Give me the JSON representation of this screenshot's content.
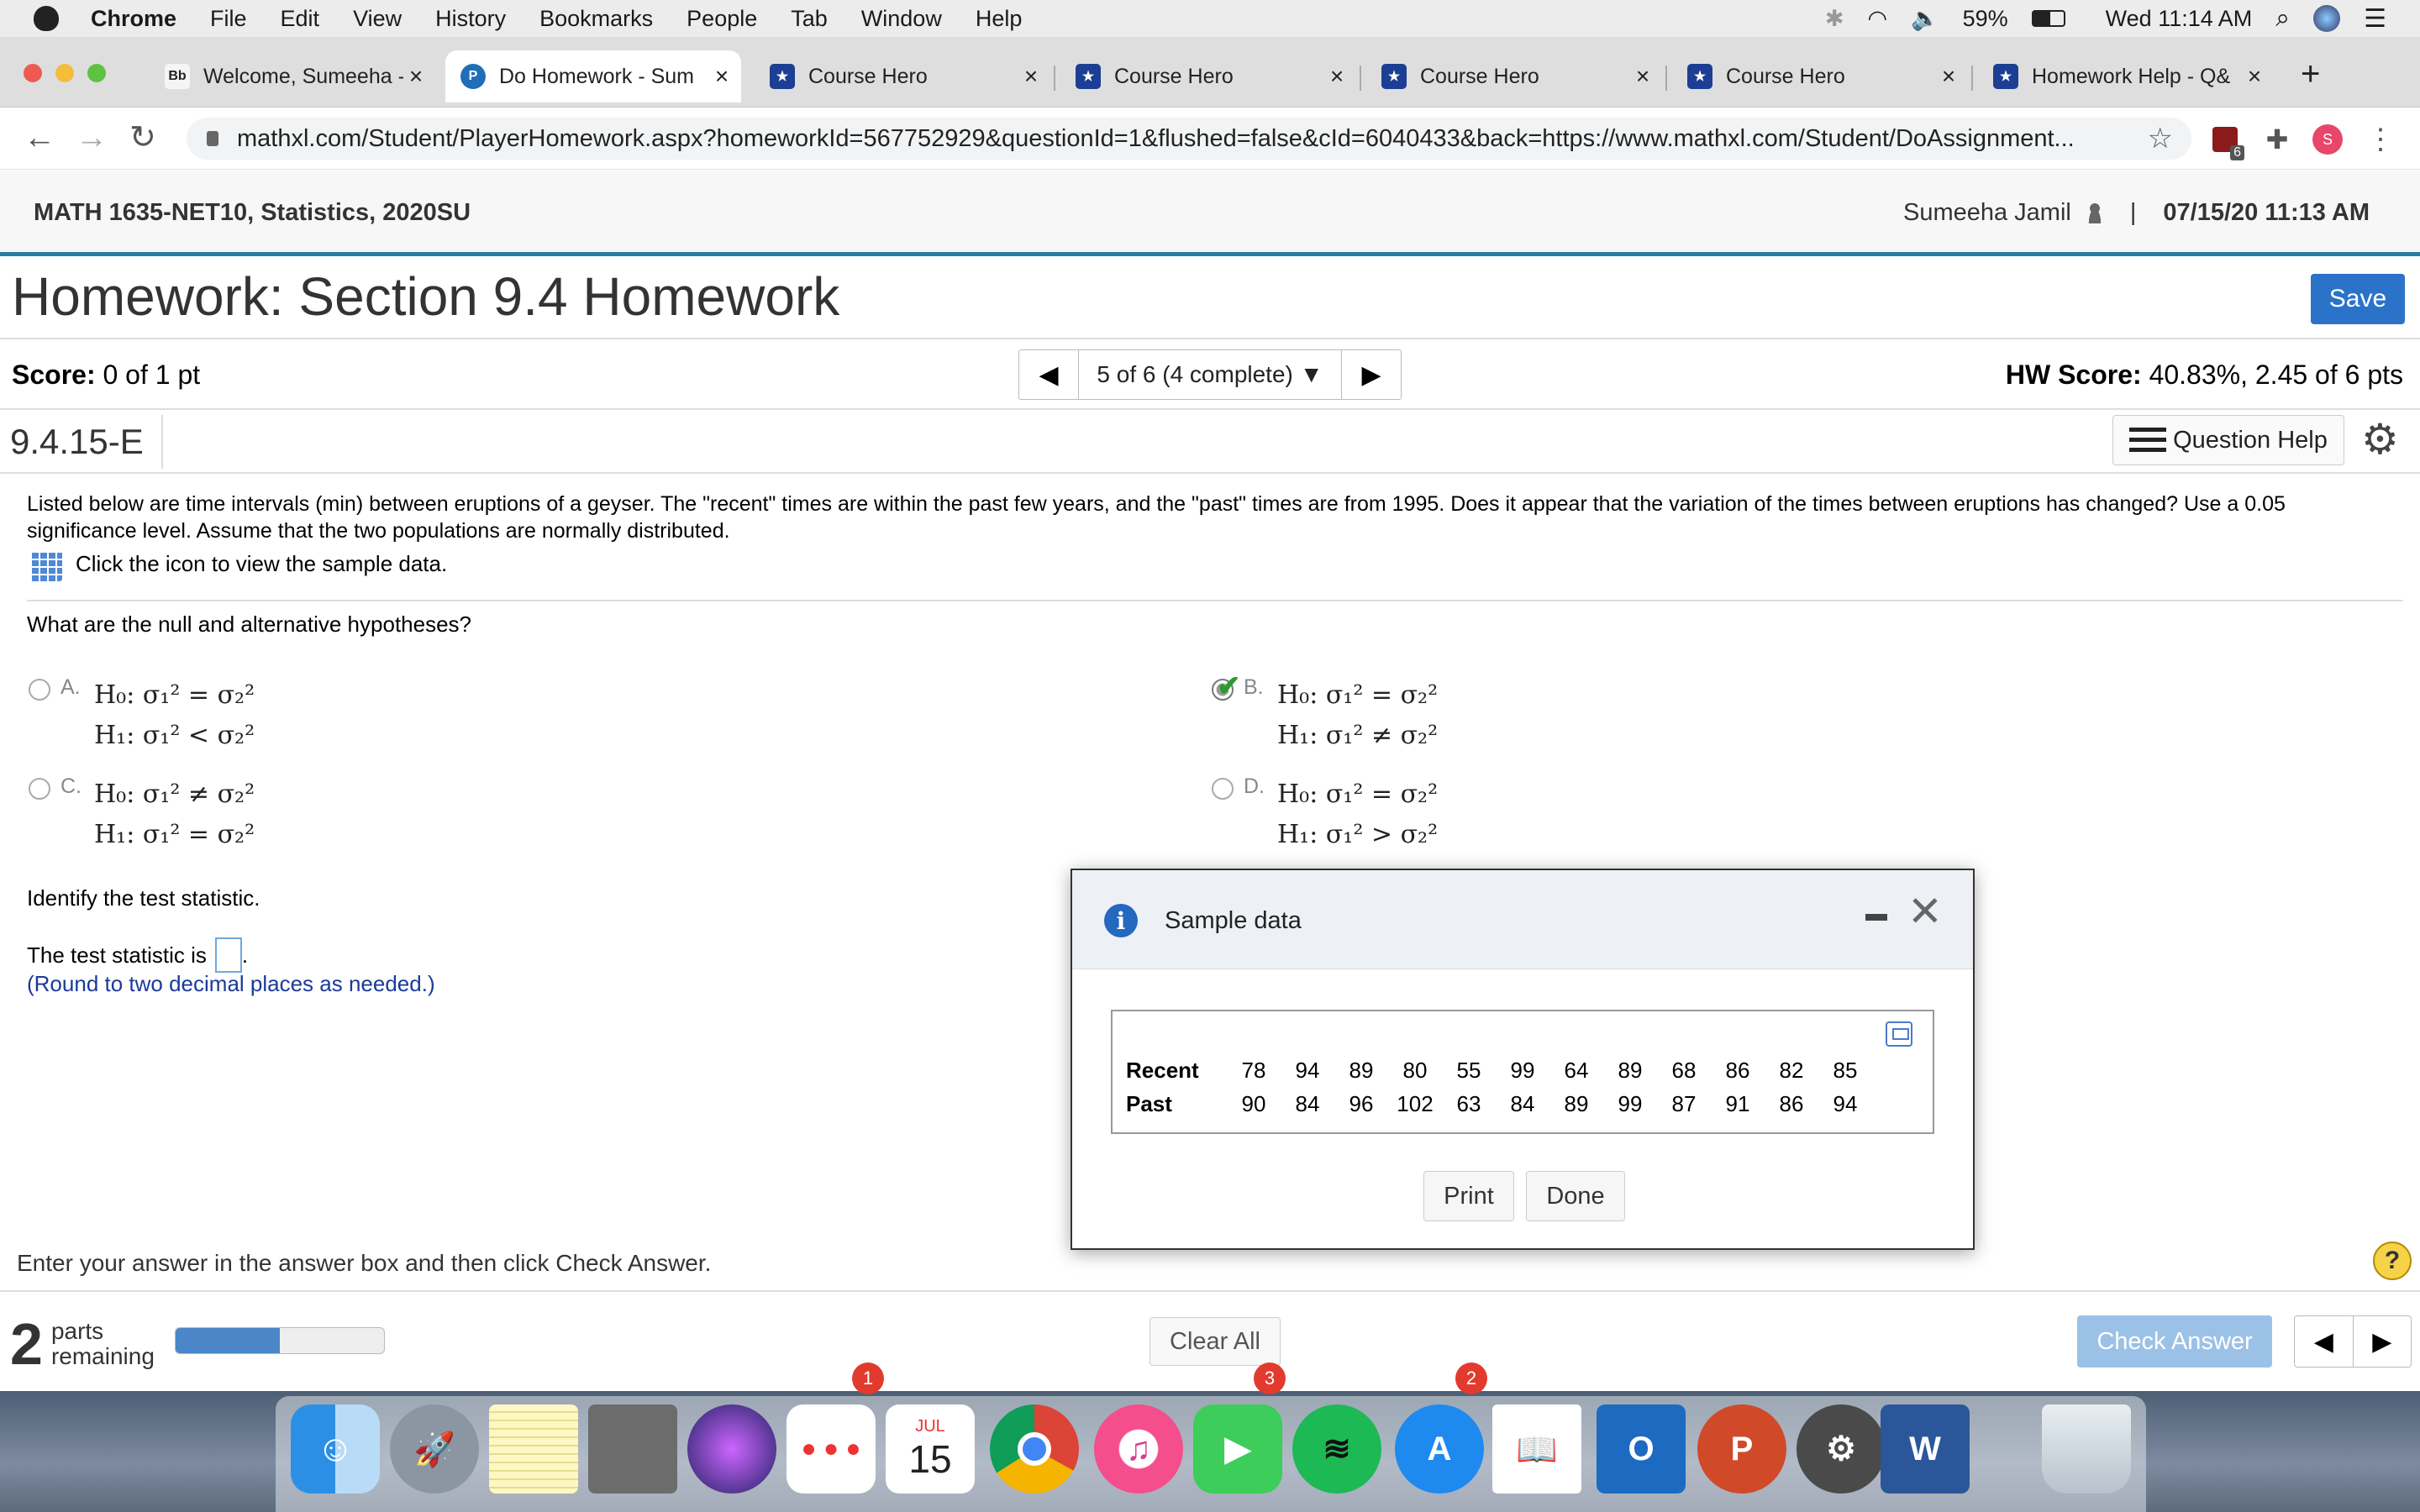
{
  "menubar": {
    "items": [
      "Chrome",
      "File",
      "Edit",
      "View",
      "History",
      "Bookmarks",
      "People",
      "Tab",
      "Window",
      "Help"
    ],
    "battery": "59%",
    "clock": "Wed 11:14 AM"
  },
  "tabs": [
    {
      "label": "Welcome, Sumeeha -",
      "fav": "Bb",
      "favcolor": "#f5f5f5",
      "favtext": "#222"
    },
    {
      "label": "Do Homework - Sum",
      "fav": "P",
      "favcolor": "#1e6fb8",
      "favtext": "#fff"
    },
    {
      "label": "Course Hero",
      "fav": "★",
      "favcolor": "#1c3f94",
      "favtext": "#fff"
    },
    {
      "label": "Course Hero",
      "fav": "★",
      "favcolor": "#1c3f94",
      "favtext": "#fff"
    },
    {
      "label": "Course Hero",
      "fav": "★",
      "favcolor": "#1c3f94",
      "favtext": "#fff"
    },
    {
      "label": "Course Hero",
      "fav": "★",
      "favcolor": "#1c3f94",
      "favtext": "#fff"
    },
    {
      "label": "Homework Help - Q&",
      "fav": "★",
      "favcolor": "#1c3f94",
      "favtext": "#fff"
    }
  ],
  "address": {
    "url": "mathxl.com/Student/PlayerHomework.aspx?homeworkId=567752929&questionId=1&flushed=false&cId=6040433&back=https://www.mathxl.com/Student/DoAssignment...",
    "ext_badge": "6",
    "profile": "S"
  },
  "course": {
    "title": "MATH 1635-NET10, Statistics, 2020SU",
    "user": "Sumeeha Jamil",
    "date": "07/15/20 11:13 AM"
  },
  "homework": {
    "title": "Homework: Section 9.4 Homework",
    "save": "Save",
    "score_label": "Score:",
    "score_value": "0 of 1 pt",
    "question_nav": "5 of 6 (4 complete)",
    "hw_score_label": "HW Score:",
    "hw_score_value": "40.83%, 2.45 of 6 pts",
    "question_id": "9.4.15-E",
    "question_help": "Question Help"
  },
  "question": {
    "text": "Listed below are time intervals (min) between eruptions of a geyser. The \"recent\" times are within the past few years, and the \"past\" times are from 1995. Does it appear that the variation of the times between eruptions has changed? Use a 0.05 significance level. Assume that the two populations are normally distributed.",
    "sample_link": "Click the icon to view the sample data.",
    "hyp_prompt": "What are the null and alternative hypotheses?",
    "options": [
      {
        "letter": "A.",
        "h0": "H₀: σ₁² = σ₂²",
        "h1": "H₁: σ₁² < σ₂²"
      },
      {
        "letter": "B.",
        "h0": "H₀: σ₁² = σ₂²",
        "h1": "H₁: σ₁² ≠ σ₂²"
      },
      {
        "letter": "C.",
        "h0": "H₀: σ₁² ≠ σ₂²",
        "h1": "H₁: σ₁² = σ₂²"
      },
      {
        "letter": "D.",
        "h0": "H₀: σ₁² = σ₂²",
        "h1": "H₁: σ₁² > σ₂²"
      }
    ],
    "selected": "B.",
    "identify": "Identify the test statistic.",
    "ts_prefix": "The test statistic is",
    "ts_suffix": ".",
    "round_note": "(Round to two decimal places as needed.)"
  },
  "footer": {
    "enter": "Enter your answer in the answer box and then click Check Answer.",
    "parts_num": "2",
    "parts_line1": "parts",
    "parts_line2": "remaining",
    "progress": 0.5,
    "clear": "Clear All",
    "check": "Check Answer"
  },
  "modal": {
    "title": "Sample data",
    "rows": [
      {
        "label": "Recent",
        "values": [
          "78",
          "94",
          "89",
          "80",
          "55",
          "99",
          "64",
          "89",
          "68",
          "86",
          "82",
          "85"
        ]
      },
      {
        "label": "Past",
        "values": [
          "90",
          "84",
          "96",
          "102",
          "63",
          "84",
          "89",
          "99",
          "87",
          "91",
          "86",
          "94"
        ]
      }
    ],
    "print": "Print",
    "done": "Done"
  },
  "dock": {
    "badges": {
      "reminders": "1",
      "facetime": "3",
      "appstore": "2"
    },
    "calendar_month": "JUL",
    "calendar_day": "15",
    "outlook": "O",
    "powerpoint": "P",
    "word": "W"
  }
}
